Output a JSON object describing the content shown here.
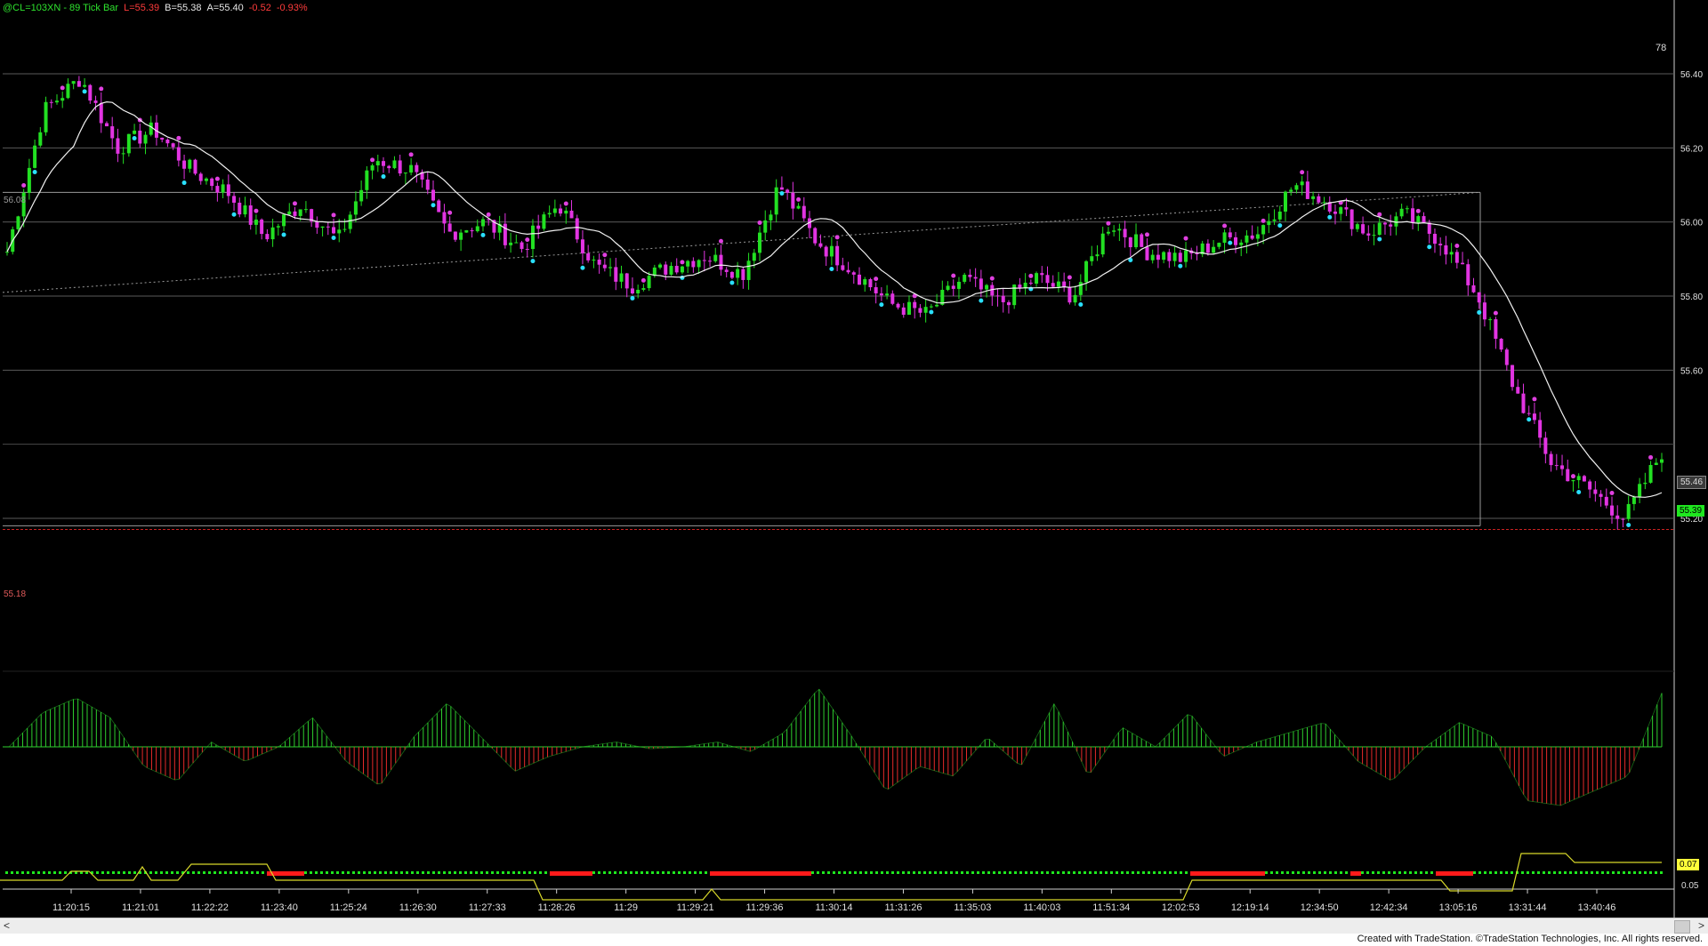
{
  "header": {
    "symbol": "@CL=103XN - 89 Tick Bar",
    "last": "L=55.39",
    "bid": "B=55.38",
    "ask": "A=55.40",
    "change": "-0.52",
    "change_pct": "-0.93%"
  },
  "right_axis": {
    "top_number": "78",
    "tag_gray": "55.46",
    "tag_green": "55.39",
    "osc_tag_yellow": "0.07",
    "osc_label": "0.05"
  },
  "left_labels": {
    "upper": "56.08",
    "lower": "55.18"
  },
  "credit": "Created with TradeStation. ©TradeStation Technologies, Inc. All rights reserved.",
  "colors": {
    "up": "#22e022",
    "down": "#e234e2",
    "ma": "#f0f0f0",
    "osc_up": "#2ecf2e",
    "osc_down": "#e62a2a",
    "dot_green": "#1fe81f",
    "dot_red": "#ff1a1a",
    "line_yellow": "#d8d82a",
    "cyan": "#2ae0ff",
    "magenta": "#e040e0"
  },
  "scrollbar": {
    "left_arrow": "<",
    "right_arrow": ">"
  },
  "chart_data": {
    "type": "candlestick",
    "y_ticks": [
      "56.40",
      "56.20",
      "56.00",
      "55.80",
      "55.60",
      "55.20"
    ],
    "ylim": [
      55.1,
      56.55
    ],
    "x_labels": [
      "11:20:15",
      "11:21:01",
      "11:22:22",
      "11:23:40",
      "11:25:24",
      "11:26:30",
      "11:27:33",
      "11:28:26",
      "11:29",
      "11:29:21",
      "11:29:36",
      "11:30:14",
      "11:31:26",
      "11:35:03",
      "11:40:03",
      "11:51:34",
      "12:02:53",
      "12:19:14",
      "12:34:50",
      "12:42:34",
      "13:05:16",
      "13:31:44",
      "13:40:46"
    ],
    "close_anchors": [
      55.92,
      56.3,
      56.39,
      56.2,
      56.25,
      56.14,
      56.08,
      55.96,
      56.05,
      55.95,
      56.17,
      56.14,
      55.97,
      56.0,
      55.93,
      56.05,
      55.88,
      55.83,
      55.88,
      55.91,
      55.86,
      56.1,
      55.95,
      55.87,
      55.78,
      55.75,
      55.85,
      55.78,
      55.85,
      55.8,
      56.0,
      55.92,
      55.9,
      55.95,
      55.97,
      56.1,
      56.05,
      55.97,
      56.02,
      55.95,
      55.8,
      55.55,
      55.35,
      55.28,
      55.2,
      55.38
    ],
    "oscillator": {
      "type": "histogram",
      "anchors": [
        0,
        0.35,
        0.5,
        0.3,
        -0.2,
        -0.35,
        0.05,
        -0.15,
        0.0,
        0.3,
        -0.15,
        -0.4,
        0.1,
        0.45,
        0.1,
        -0.25,
        -0.1,
        0.0,
        0.05,
        -0.02,
        0.0,
        0.05,
        -0.05,
        0.15,
        0.6,
        0.1,
        -0.45,
        -0.2,
        -0.3,
        0.1,
        -0.2,
        0.45,
        -0.3,
        0.2,
        0.0,
        0.35,
        -0.1,
        0.05,
        0.15,
        0.25,
        -0.15,
        -0.35,
        0.0,
        0.25,
        0.1,
        -0.55,
        -0.6,
        -0.45,
        -0.3,
        0.55
      ]
    },
    "signal_line": {
      "green_dots": true,
      "red_segments_pct": [
        [
          0.16,
          0.18
        ],
        [
          0.33,
          0.355
        ],
        [
          0.425,
          0.485
        ],
        [
          0.715,
          0.76
        ],
        [
          0.81,
          0.815
        ],
        [
          0.86,
          0.885
        ]
      ]
    },
    "grid": true,
    "legend": "none"
  }
}
